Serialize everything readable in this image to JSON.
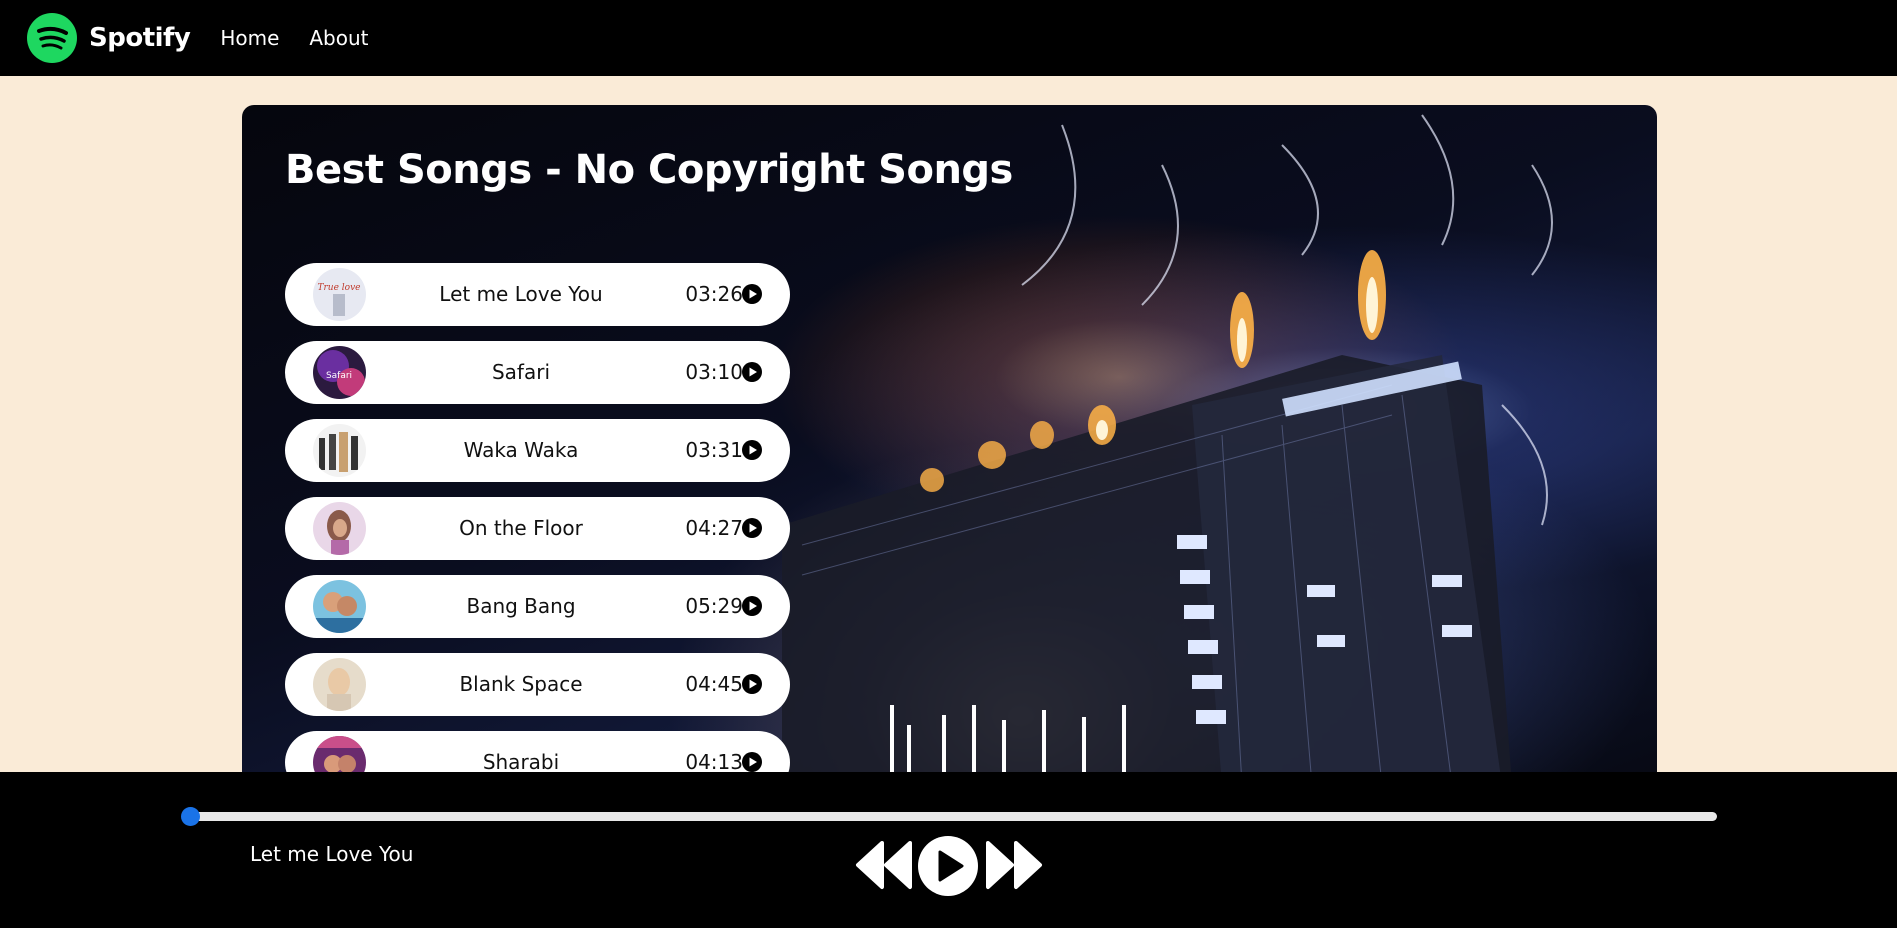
{
  "nav": {
    "brand": "Spotify",
    "links": [
      "Home",
      "About"
    ]
  },
  "main": {
    "title": "Best Songs - No Copyright Songs",
    "songs": [
      {
        "name": "Let me Love You",
        "duration": "03:26"
      },
      {
        "name": "Safari",
        "duration": "03:10"
      },
      {
        "name": "Waka Waka",
        "duration": "03:31"
      },
      {
        "name": "On the Floor",
        "duration": "04:27"
      },
      {
        "name": "Bang Bang",
        "duration": "05:29"
      },
      {
        "name": "Blank Space",
        "duration": "04:45"
      },
      {
        "name": "Sharabi",
        "duration": "04:13"
      }
    ]
  },
  "player": {
    "now_playing": "Let me Love You",
    "progress": 0
  },
  "colors": {
    "nav_bg": "#000000",
    "page_bg": "#faebd7",
    "brand_green": "#1ed760",
    "progress_thumb": "#1a73e8"
  },
  "icons": {
    "logo": "spotify-logo-icon",
    "song_play": "play-circle-icon",
    "previous": "previous-icon",
    "play": "play-icon",
    "next": "next-icon"
  }
}
